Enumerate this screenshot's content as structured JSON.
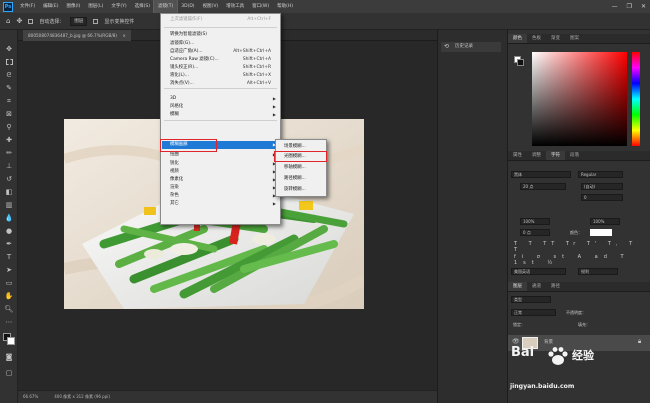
{
  "menubar": {
    "logo": "Ps",
    "items": [
      "文件(F)",
      "编辑(E)",
      "图像(I)",
      "图层(L)",
      "文字(Y)",
      "选择(S)",
      "滤镜(T)",
      "3D(D)",
      "视图(V)",
      "增效工具",
      "窗口(W)",
      "帮助(H)"
    ],
    "active_index": 6,
    "window_controls": [
      "—",
      "❐",
      "✕"
    ]
  },
  "options_bar": {
    "auto_select": "自动选择：",
    "layer_select": "图层",
    "show_transform": "显示变换控件"
  },
  "document": {
    "tab_title": "800508074836487_b.jpg @ 66.7%(RGB/8)",
    "zoom": "66.67%",
    "doc_info": "400 像素 x 312 像素 (96 ppi)"
  },
  "filter_menu": {
    "items": [
      {
        "label": "上次滤镜操作(F)",
        "shortcut": "Alt+Ctrl+F",
        "disabled": true,
        "arrow": false
      },
      {
        "label": "转换为智能滤镜(S)",
        "shortcut": "",
        "disabled": false,
        "arrow": false
      },
      {
        "label": "滤镜库(G)...",
        "shortcut": "",
        "disabled": false,
        "arrow": false
      },
      {
        "label": "自适应广角(A)...",
        "shortcut": "Alt+Shift+Ctrl+A",
        "disabled": false,
        "arrow": false
      },
      {
        "label": "Camera Raw 滤镜(C)...",
        "shortcut": "Shift+Ctrl+A",
        "disabled": false,
        "arrow": false
      },
      {
        "label": "镜头校正(R)...",
        "shortcut": "Shift+Ctrl+R",
        "disabled": false,
        "arrow": false
      },
      {
        "label": "液化(L)...",
        "shortcut": "Shift+Ctrl+X",
        "disabled": false,
        "arrow": false
      },
      {
        "label": "消失点(V)...",
        "shortcut": "Alt+Ctrl+V",
        "disabled": false,
        "arrow": false
      },
      {
        "label": "3D",
        "shortcut": "",
        "disabled": false,
        "arrow": true
      },
      {
        "label": "风格化",
        "shortcut": "",
        "disabled": false,
        "arrow": true
      },
      {
        "label": "模糊",
        "shortcut": "",
        "disabled": false,
        "arrow": true
      },
      {
        "label": "模糊画廊",
        "shortcut": "",
        "disabled": false,
        "arrow": true
      },
      {
        "label": "扭曲",
        "shortcut": "",
        "disabled": false,
        "arrow": true
      },
      {
        "label": "锐化",
        "shortcut": "",
        "disabled": false,
        "arrow": true
      },
      {
        "label": "视频",
        "shortcut": "",
        "disabled": false,
        "arrow": true
      },
      {
        "label": "像素化",
        "shortcut": "",
        "disabled": false,
        "arrow": true
      },
      {
        "label": "渲染",
        "shortcut": "",
        "disabled": false,
        "arrow": true
      },
      {
        "label": "杂色",
        "shortcut": "",
        "disabled": false,
        "arrow": true
      },
      {
        "label": "其它",
        "shortcut": "",
        "disabled": false,
        "arrow": true
      }
    ],
    "highlight_index": 11
  },
  "blur_gallery_submenu": {
    "items": [
      "场景模糊...",
      "光圈模糊...",
      "移轴模糊...",
      "路径模糊...",
      "旋转模糊..."
    ],
    "boxed_index": 1
  },
  "panels": {
    "history_label": "历史记录",
    "color_tabs": [
      "颜色",
      "色板",
      "渐变",
      "图案"
    ],
    "char_tabs": [
      "属性",
      "调整",
      "字符",
      "段落"
    ],
    "font_family": "黑体",
    "font_style": "Regular",
    "font_size": "20 点",
    "leading": "(自动)",
    "tracking": "0",
    "scale_v": "100%",
    "scale_h": "100%",
    "baseline": "0 点",
    "color_label": "颜色：",
    "language": "美国英语",
    "aa": "锐利",
    "layer_tabs": [
      "图层",
      "通道",
      "路径"
    ],
    "layer_kind": "类型",
    "blend_mode": "正常",
    "opacity": "不透明度：",
    "lock": "锁定：",
    "fill": "填充：",
    "layer_name": "背景"
  },
  "watermark": {
    "left": "Bai",
    "right": "经验",
    "url": "jingyan.baidu.com"
  },
  "colors": {
    "highlight": "#1f7ad6",
    "annotation": "#e0262b"
  }
}
